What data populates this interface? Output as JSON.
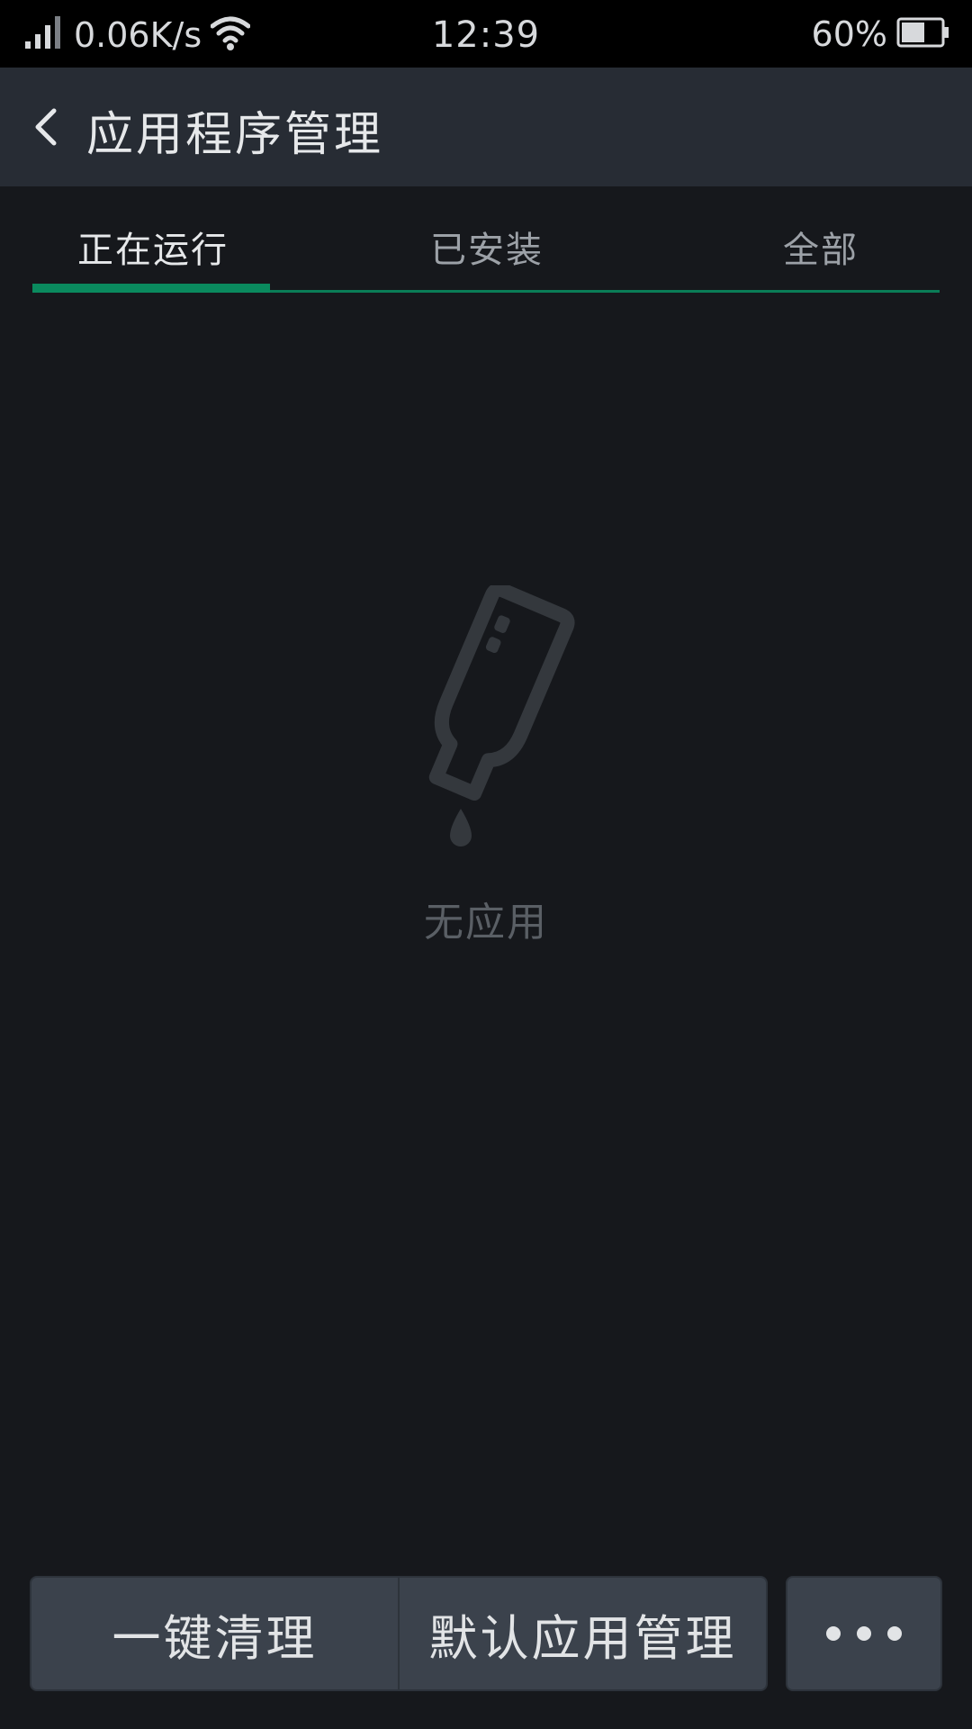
{
  "status_bar": {
    "net_speed": "0.06K/s",
    "time": "12:39",
    "battery_percent": "60%",
    "battery_level": 0.6,
    "icons": [
      "signal-icon",
      "wifi-icon",
      "battery-icon"
    ]
  },
  "header": {
    "title": "应用程序管理"
  },
  "tabs": [
    {
      "label": "正在运行",
      "active": true
    },
    {
      "label": "已安装",
      "active": false
    },
    {
      "label": "全部",
      "active": false
    }
  ],
  "empty_state": {
    "icon": "empty-bottle-icon",
    "text": "无应用"
  },
  "bottom_actions": {
    "clean_label": "一键清理",
    "default_apps_label": "默认应用管理",
    "more_icon": "more-dots-icon"
  },
  "colors": {
    "accent": "#0a8a5e",
    "background": "#16181c",
    "app_bar": "#272c34",
    "button": "#3b424c"
  }
}
